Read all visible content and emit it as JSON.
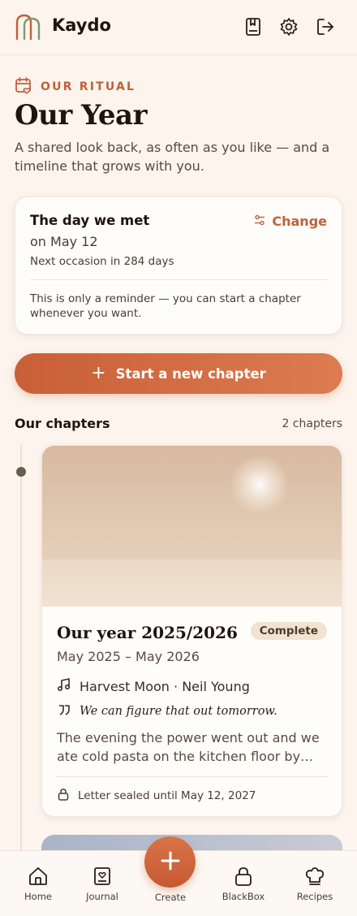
{
  "app": {
    "name": "Kaydo"
  },
  "header": {
    "icons": [
      "bookmark-book-icon",
      "gear-icon",
      "logout-icon"
    ]
  },
  "ritual": {
    "label": "OUR RITUAL",
    "icon": "calendar-heart-icon"
  },
  "page": {
    "title": "Our Year",
    "subtitle": "A shared look back, as often as you like — and a timeline that grows with you."
  },
  "occasion": {
    "title": "The day we met",
    "date": "on May 12",
    "next": "Next occasion in 284 days",
    "change_label": "Change",
    "note": "This is only a reminder — you can start a chapter whenever you want."
  },
  "actions": {
    "start_label": "Start a new chapter"
  },
  "chapters": {
    "heading": "Our chapters",
    "count": "2 chapters",
    "items": [
      {
        "title": "Our year 2025/2026",
        "status": "Complete",
        "range": "May 2025 – May 2026",
        "song": "Harvest Moon · Neil Young",
        "quote": "We can figure that out tomorrow.",
        "description": "The evening the power went out and we ate cold pasta on the kitchen floor by…",
        "letter": "Letter sealed until May 12, 2027"
      }
    ]
  },
  "nav": {
    "items": [
      {
        "label": "Home",
        "icon": "home-icon"
      },
      {
        "label": "Journal",
        "icon": "journal-icon"
      },
      {
        "label": "Create",
        "icon": "plus-icon"
      },
      {
        "label": "BlackBox",
        "icon": "lock-icon"
      },
      {
        "label": "Recipes",
        "icon": "chef-hat-icon"
      }
    ]
  },
  "colors": {
    "accent": "#c0603a",
    "background": "#fcf4ed",
    "text": "#1f140e"
  }
}
